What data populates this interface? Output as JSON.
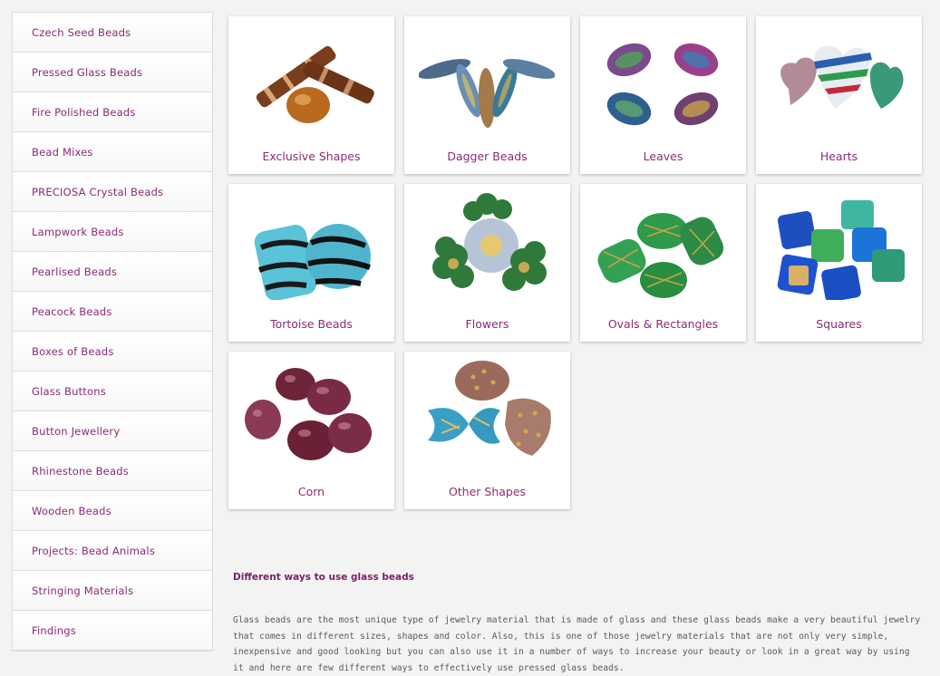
{
  "sidebar": {
    "items": [
      {
        "label": "Czech Seed Beads"
      },
      {
        "label": "Pressed Glass Beads"
      },
      {
        "label": "Fire Polished Beads"
      },
      {
        "label": "Bead Mixes"
      },
      {
        "label": "PRECIOSA Crystal Beads"
      },
      {
        "label": "Lampwork Beads"
      },
      {
        "label": "Pearlised Beads"
      },
      {
        "label": "Peacock Beads"
      },
      {
        "label": "Boxes of Beads"
      },
      {
        "label": "Glass Buttons"
      },
      {
        "label": "Button Jewellery"
      },
      {
        "label": "Rhinestone Beads"
      },
      {
        "label": "Wooden Beads"
      },
      {
        "label": "Projects: Bead Animals"
      },
      {
        "label": "Stringing Materials"
      },
      {
        "label": "Findings"
      }
    ]
  },
  "categories": [
    {
      "label": "Exclusive Shapes"
    },
    {
      "label": "Dagger Beads"
    },
    {
      "label": "Leaves"
    },
    {
      "label": "Hearts"
    },
    {
      "label": "Tortoise Beads"
    },
    {
      "label": "Flowers"
    },
    {
      "label": "Ovals & Rectangles"
    },
    {
      "label": "Squares"
    },
    {
      "label": "Corn"
    },
    {
      "label": "Other Shapes"
    }
  ],
  "article": {
    "heading": "Different ways to use glass beads",
    "body": "Glass beads are the most unique type of jewelry material that is made of glass and these glass beads make a very beautiful jewelry that comes in different sizes, shapes and color. Also, this is one of those jewelry materials that are not only very simple, inexpensive and good looking but you can also use it in a number of ways to increase your beauty or look in a great way by using it and here are few different ways to effectively use pressed glass beads."
  },
  "colors": {
    "accent": "#8e2a78",
    "heading": "#7a1f6a",
    "body_text": "#5a5a5a"
  }
}
